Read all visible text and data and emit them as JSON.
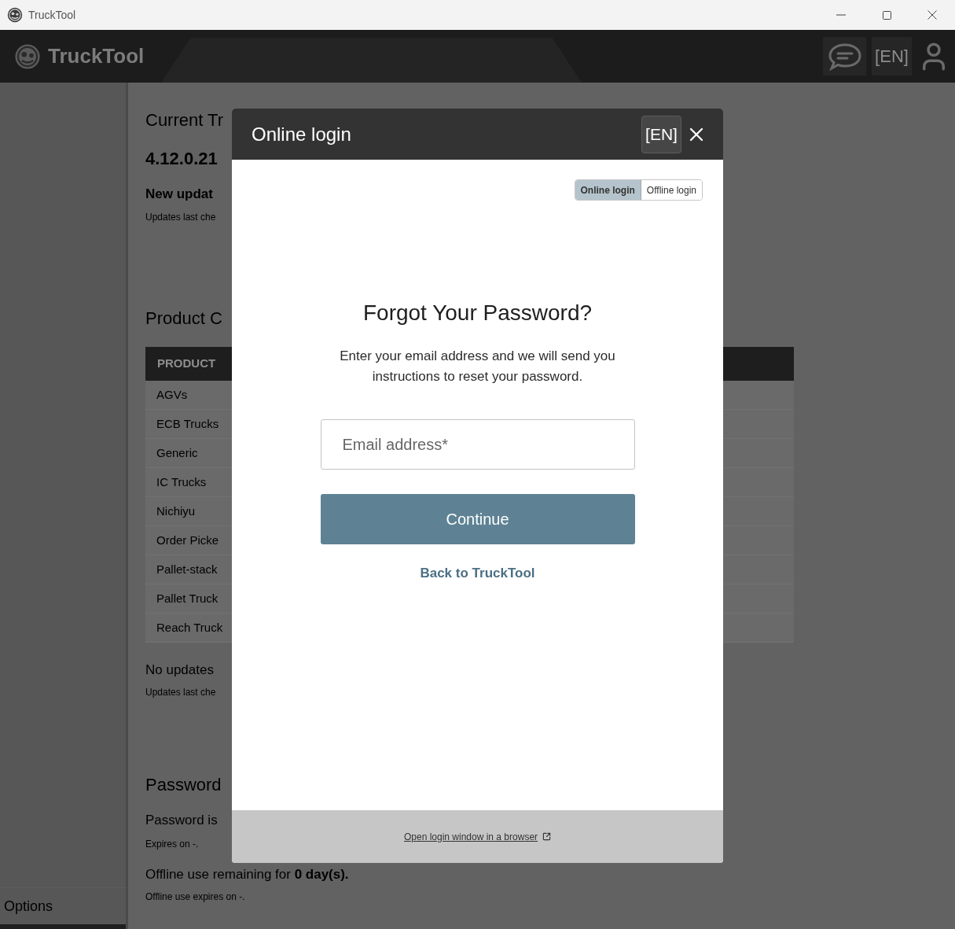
{
  "window": {
    "title": "TruckTool"
  },
  "app_header": {
    "brand": "TruckTool",
    "language": "[EN]"
  },
  "sidebar": {
    "footer_item": "Options"
  },
  "current_section": {
    "heading": "Current Tr",
    "version": "4.12.0.21",
    "status": "New updat",
    "checked_note": "Updates last che"
  },
  "product_section": {
    "heading": "Product C",
    "table": {
      "columns": [
        "PRODUCT"
      ],
      "rows": [
        [
          "AGVs"
        ],
        [
          "ECB Trucks"
        ],
        [
          "Generic"
        ],
        [
          "IC Trucks"
        ],
        [
          "Nichiyu"
        ],
        [
          "Order Picke"
        ],
        [
          "Pallet-stack"
        ],
        [
          "Pallet Truck"
        ],
        [
          "Reach Truck"
        ]
      ]
    },
    "status": "No updates",
    "checked_note": "Updates last che"
  },
  "password_section": {
    "heading": "Password",
    "status": "Password is",
    "expiry": "Expires on -.",
    "offline_remaining": "Offline use remaining for **0 day(s).**",
    "offline_expiry": "Offline use expires on -."
  },
  "dialog": {
    "title": "Online login",
    "language": "[EN]",
    "mode_tabs": [
      {
        "label": "Online login",
        "selected": true
      },
      {
        "label": "Offline login",
        "selected": false
      }
    ],
    "heading": "Forgot Your Password?",
    "description": "Enter your email address and we will send you instructions to reset your password.",
    "email_field": {
      "placeholder": "Email address*"
    },
    "continue_button": "Continue",
    "back_link": "Back to TruckTool",
    "footer_link": "Open login window in a browser"
  }
}
